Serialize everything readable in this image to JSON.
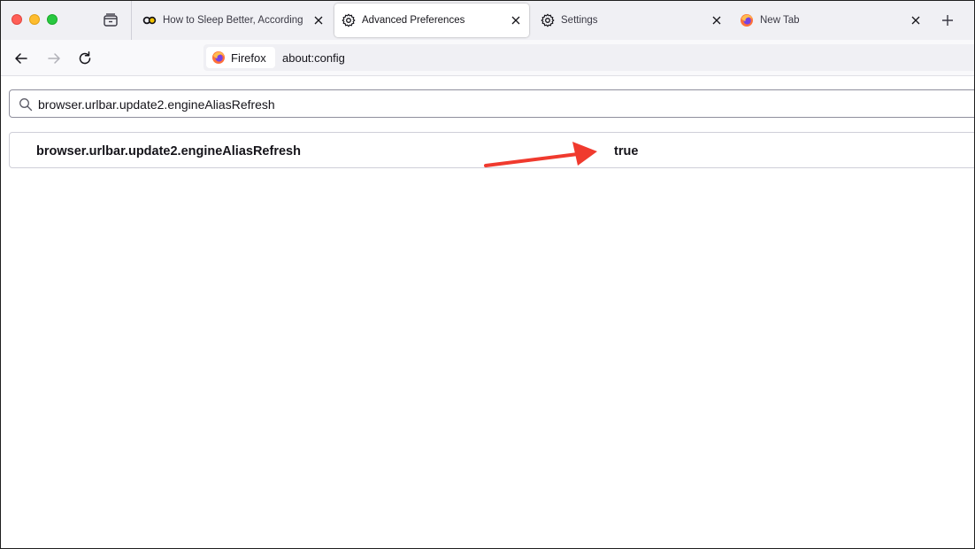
{
  "tabs": [
    {
      "title": "How to Sleep Better, According",
      "favicon": "goodhousekeeping-icon",
      "active": false
    },
    {
      "title": "Advanced Preferences",
      "favicon": "gear-icon",
      "active": true
    },
    {
      "title": "Settings",
      "favicon": "gear-icon",
      "active": false
    },
    {
      "title": "New Tab",
      "favicon": "firefox-icon",
      "active": false
    }
  ],
  "urlbar": {
    "identity_label": "Firefox",
    "url": "about:config"
  },
  "search": {
    "value": "browser.urlbar.update2.engineAliasRefresh"
  },
  "preference": {
    "name": "browser.urlbar.update2.engineAliasRefresh",
    "value": "true"
  },
  "colors": {
    "annotation_arrow": "#f03a2e",
    "tabstrip_bg": "#f0f0f4"
  }
}
